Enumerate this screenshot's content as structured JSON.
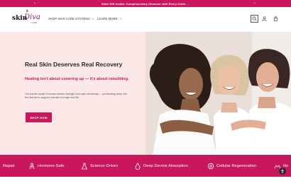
{
  "announcement": {
    "text": "Slide Gift Inside: Complimentary Cleanser with Every Order →",
    "prev": "‹",
    "next": "›"
  },
  "brand": {
    "skin": "skin",
    "diva": "Diva",
    "care": "CARE"
  },
  "nav": {
    "items": [
      {
        "label": "SHOP SKIN CARE SYSTEMS",
        "chevron": "˅"
      },
      {
        "label": "LEARN MORE",
        "chevron": "˅"
      }
    ]
  },
  "header_icons": [
    "search-icon",
    "account-icon",
    "cart-icon"
  ],
  "hero": {
    "title": "Real Skin Deserves Real Recovery",
    "subtitle": "Healing isn't about covering up — it's about rebuilding.",
    "body": "Our barrier-repair formulas restore strength and calm sensitivity — penetrating deep into the dermis to support real skin through real life.",
    "cta": "SHOP NOW"
  },
  "features": [
    {
      "label": "Repair",
      "icon": "hands-icon"
    },
    {
      "label": "Hormone-Safe",
      "icon": "person-icon"
    },
    {
      "label": "Science-Driven",
      "icon": "flask-icon"
    },
    {
      "label": "Deep Dermis Absorption",
      "icon": "drop-icon"
    },
    {
      "label": "Cellular Regeneration",
      "icon": "cell-icon"
    },
    {
      "label": "No",
      "icon": "hands-icon"
    }
  ],
  "colors": {
    "brand_pink": "#c8175d",
    "hero_bg": "#fde8e8",
    "logo_purple": "#7a1d6a"
  }
}
